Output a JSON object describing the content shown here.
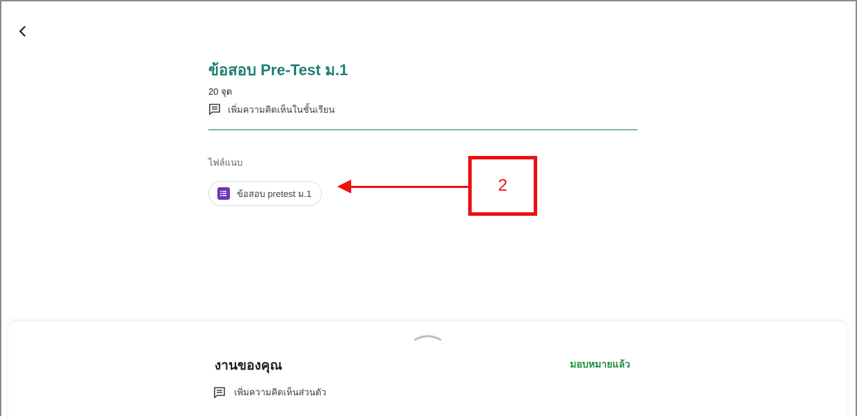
{
  "assignment": {
    "title": "ข้อสอบ Pre-Test ม.1",
    "points": "20 จุด",
    "class_comment": "เพิ่มความคิดเห็นในชั้นเรียน",
    "attachments_label": "ไฟล์แนบ",
    "attachment": {
      "name": "ข้อสอบ pretest ม.1",
      "icon": "google-forms-icon",
      "icon_color": "#673ab7"
    }
  },
  "annotation": {
    "label": "2",
    "color": "#ee1111"
  },
  "your_work": {
    "title": "งานของคุณ",
    "status": "มอบหมายแล้ว",
    "private_comment": "เพิ่มความคิดเห็นส่วนตัว"
  },
  "colors": {
    "title": "#1e7e74",
    "status": "#1e8e3e"
  }
}
